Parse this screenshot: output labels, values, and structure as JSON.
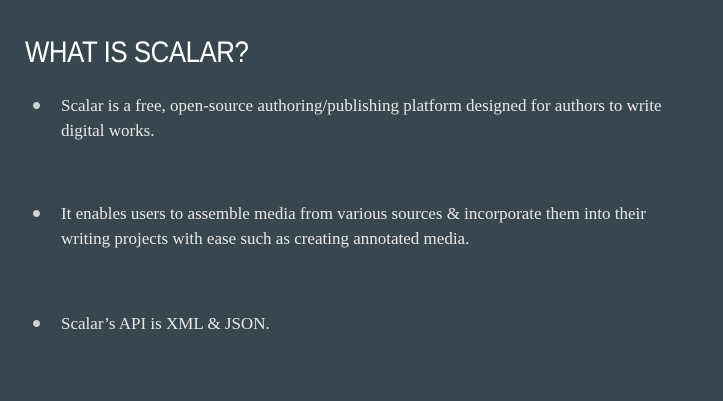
{
  "slide": {
    "title": "WHAT IS SCALAR?",
    "bullets": [
      "Scalar is a free, open-source authoring/publishing platform designed for authors to write digital works.",
      "It enables users to assemble media from various sources & incorporate them into their writing projects with ease such as creating annotated media.",
      "Scalar’s API is XML & JSON."
    ]
  },
  "colors": {
    "background": "#37464f",
    "title": "#ffffff",
    "text": "#e6e6e6"
  }
}
